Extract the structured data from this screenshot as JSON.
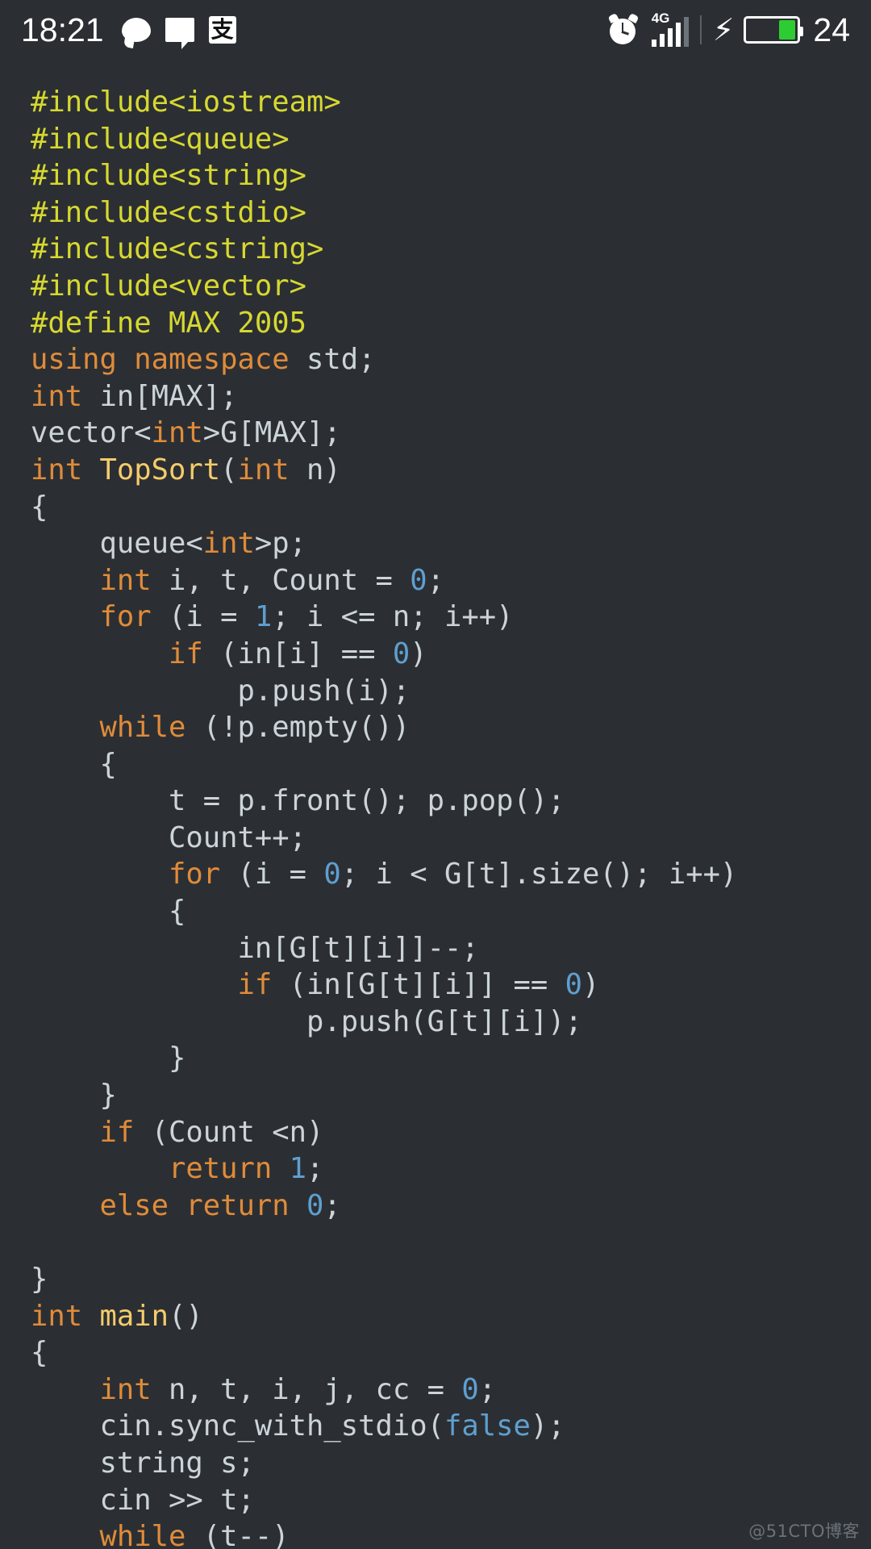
{
  "status_bar": {
    "clock": "18:21",
    "battery_percent": "24",
    "network_label": "4G",
    "icons": [
      {
        "name": "chat-bubble-round-icon",
        "glyph": "speech-bubble"
      },
      {
        "name": "chat-bubble-square-icon",
        "glyph": "message"
      },
      {
        "name": "alipay-icon",
        "glyph": "支"
      },
      {
        "name": "alarm-clock-icon",
        "glyph": "alarm"
      },
      {
        "name": "signal-bars-icon",
        "glyph": "signal"
      },
      {
        "name": "charging-bolt-icon",
        "glyph": "⚡"
      },
      {
        "name": "battery-icon",
        "glyph": "battery"
      }
    ],
    "colors": {
      "background": "#2b2f33",
      "foreground": "#ffffff",
      "battery_fill": "#2ecc33",
      "signal_inactive": "#6d7479"
    }
  },
  "editor": {
    "language": "C++",
    "theme_colors": {
      "background": "#2b2f33",
      "plain": "#ccd4da",
      "preprocessor": "#d7d830",
      "keyword": "#e08b3a",
      "function": "#f5cb6b",
      "number": "#5f9fd0"
    },
    "lines": [
      [
        [
          "pre",
          "#include<iostream>"
        ]
      ],
      [
        [
          "pre",
          "#include<queue>"
        ]
      ],
      [
        [
          "pre",
          "#include<string>"
        ]
      ],
      [
        [
          "pre",
          "#include<cstdio>"
        ]
      ],
      [
        [
          "pre",
          "#include<cstring>"
        ]
      ],
      [
        [
          "pre",
          "#include<vector>"
        ]
      ],
      [
        [
          "pre",
          "#define MAX 2005"
        ]
      ],
      [
        [
          "kw",
          "using namespace"
        ],
        [
          "txt",
          " std;"
        ]
      ],
      [
        [
          "kw",
          "int"
        ],
        [
          "txt",
          " in[MAX];"
        ]
      ],
      [
        [
          "txt",
          "vector<"
        ],
        [
          "kw",
          "int"
        ],
        [
          "txt",
          ">G[MAX];"
        ]
      ],
      [
        [
          "kw",
          "int"
        ],
        [
          "txt",
          " "
        ],
        [
          "fn",
          "TopSort"
        ],
        [
          "txt",
          "("
        ],
        [
          "kw",
          "int"
        ],
        [
          "txt",
          " n)"
        ]
      ],
      [
        [
          "txt",
          "{"
        ]
      ],
      [
        [
          "txt",
          "    queue<"
        ],
        [
          "kw",
          "int"
        ],
        [
          "txt",
          ">p;"
        ]
      ],
      [
        [
          "txt",
          "    "
        ],
        [
          "kw",
          "int"
        ],
        [
          "txt",
          " i, t, Count = "
        ],
        [
          "num",
          "0"
        ],
        [
          "txt",
          ";"
        ]
      ],
      [
        [
          "txt",
          "    "
        ],
        [
          "kw",
          "for"
        ],
        [
          "txt",
          " (i = "
        ],
        [
          "num",
          "1"
        ],
        [
          "txt",
          "; i <= n; i++)"
        ]
      ],
      [
        [
          "txt",
          "        "
        ],
        [
          "kw",
          "if"
        ],
        [
          "txt",
          " (in[i] == "
        ],
        [
          "num",
          "0"
        ],
        [
          "txt",
          ")"
        ]
      ],
      [
        [
          "txt",
          "            p.push(i);"
        ]
      ],
      [
        [
          "txt",
          "    "
        ],
        [
          "kw",
          "while"
        ],
        [
          "txt",
          " (!p.empty())"
        ]
      ],
      [
        [
          "txt",
          "    {"
        ]
      ],
      [
        [
          "txt",
          "        t = p.front(); p.pop();"
        ]
      ],
      [
        [
          "txt",
          "        Count++;"
        ]
      ],
      [
        [
          "txt",
          "        "
        ],
        [
          "kw",
          "for"
        ],
        [
          "txt",
          " (i = "
        ],
        [
          "num",
          "0"
        ],
        [
          "txt",
          "; i < G[t].size(); i++)"
        ]
      ],
      [
        [
          "txt",
          "        {"
        ]
      ],
      [
        [
          "txt",
          "            in[G[t][i]]--;"
        ]
      ],
      [
        [
          "txt",
          "            "
        ],
        [
          "kw",
          "if"
        ],
        [
          "txt",
          " (in[G[t][i]] == "
        ],
        [
          "num",
          "0"
        ],
        [
          "txt",
          ")"
        ]
      ],
      [
        [
          "txt",
          "                p.push(G[t][i]);"
        ]
      ],
      [
        [
          "txt",
          "        }"
        ]
      ],
      [
        [
          "txt",
          "    }"
        ]
      ],
      [
        [
          "txt",
          "    "
        ],
        [
          "kw",
          "if"
        ],
        [
          "txt",
          " (Count <n)"
        ]
      ],
      [
        [
          "txt",
          "        "
        ],
        [
          "kw",
          "return"
        ],
        [
          "txt",
          " "
        ],
        [
          "num",
          "1"
        ],
        [
          "txt",
          ";"
        ]
      ],
      [
        [
          "txt",
          "    "
        ],
        [
          "kw",
          "else return"
        ],
        [
          "txt",
          " "
        ],
        [
          "num",
          "0"
        ],
        [
          "txt",
          ";"
        ]
      ],
      [
        [
          "txt",
          ""
        ]
      ],
      [
        [
          "txt",
          "}"
        ]
      ],
      [
        [
          "kw",
          "int"
        ],
        [
          "txt",
          " "
        ],
        [
          "fn",
          "main"
        ],
        [
          "txt",
          "()"
        ]
      ],
      [
        [
          "txt",
          "{"
        ]
      ],
      [
        [
          "txt",
          "    "
        ],
        [
          "kw",
          "int"
        ],
        [
          "txt",
          " n, t, i, j, cc = "
        ],
        [
          "num",
          "0"
        ],
        [
          "txt",
          ";"
        ]
      ],
      [
        [
          "txt",
          "    cin.sync_with_stdio("
        ],
        [
          "num",
          "false"
        ],
        [
          "txt",
          ");"
        ]
      ],
      [
        [
          "txt",
          "    string s;"
        ]
      ],
      [
        [
          "txt",
          "    cin >> t;"
        ]
      ],
      [
        [
          "txt",
          "    "
        ],
        [
          "kw",
          "while"
        ],
        [
          "txt",
          " (t--)"
        ]
      ]
    ]
  },
  "watermark": {
    "text": "@51CTO博客"
  }
}
